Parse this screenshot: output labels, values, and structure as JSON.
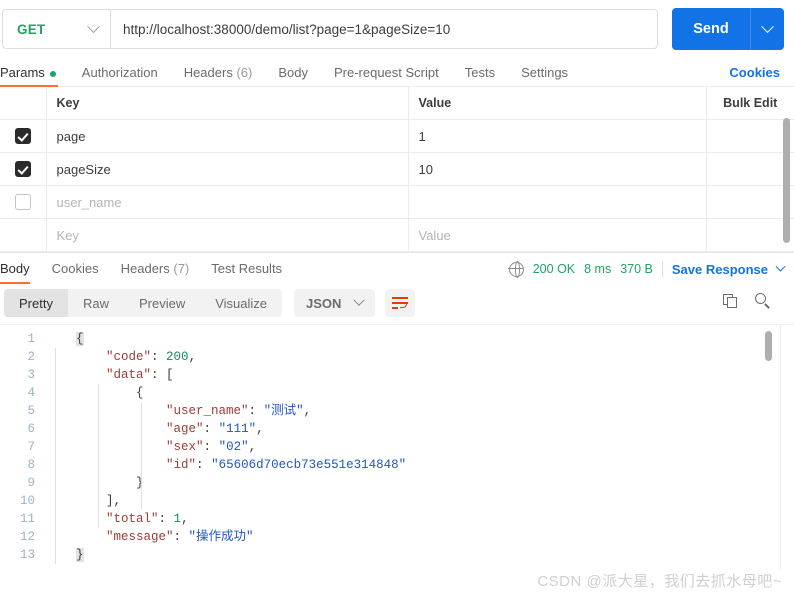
{
  "request": {
    "method": "GET",
    "url": "http://localhost:38000/demo/list?page=1&pageSize=10",
    "send_label": "Send",
    "tabs": [
      {
        "label": "Params",
        "badge": "",
        "active": true,
        "dot": true
      },
      {
        "label": "Authorization",
        "badge": "",
        "active": false,
        "dot": false
      },
      {
        "label": "Headers",
        "badge": "(6)",
        "active": false,
        "dot": false
      },
      {
        "label": "Body",
        "badge": "",
        "active": false,
        "dot": false
      },
      {
        "label": "Pre-request Script",
        "badge": "",
        "active": false,
        "dot": false
      },
      {
        "label": "Tests",
        "badge": "",
        "active": false,
        "dot": false
      },
      {
        "label": "Settings",
        "badge": "",
        "active": false,
        "dot": false
      }
    ],
    "cookies_link": "Cookies"
  },
  "params_table": {
    "headers": {
      "key": "Key",
      "value": "Value",
      "bulk_edit": "Bulk Edit"
    },
    "rows": [
      {
        "checked": true,
        "key": "page",
        "value": "1",
        "placeholder": false
      },
      {
        "checked": true,
        "key": "pageSize",
        "value": "10",
        "placeholder": false
      },
      {
        "checked": false,
        "key": "user_name",
        "value": "",
        "placeholder": true
      },
      {
        "checked": null,
        "key": "Key",
        "value": "Value",
        "placeholder": true
      }
    ]
  },
  "response": {
    "tabs": [
      {
        "label": "Body",
        "badge": "",
        "active": true
      },
      {
        "label": "Cookies",
        "badge": "",
        "active": false
      },
      {
        "label": "Headers",
        "badge": "(7)",
        "active": false
      },
      {
        "label": "Test Results",
        "badge": "",
        "active": false
      }
    ],
    "status": "200 OK",
    "time": "8 ms",
    "size": "370 B",
    "save_response": "Save Response",
    "view_modes": [
      {
        "label": "Pretty",
        "active": true
      },
      {
        "label": "Raw",
        "active": false
      },
      {
        "label": "Preview",
        "active": false
      },
      {
        "label": "Visualize",
        "active": false
      }
    ],
    "format": "JSON",
    "body_lines": [
      {
        "n": "1",
        "indent": 0,
        "tokens": [
          {
            "t": "{",
            "c": "brace-hl"
          }
        ]
      },
      {
        "n": "2",
        "indent": 1,
        "tokens": [
          {
            "t": "\"code\"",
            "c": "k-key"
          },
          {
            "t": ": ",
            "c": "k-pun"
          },
          {
            "t": "200",
            "c": "k-num"
          },
          {
            "t": ",",
            "c": "k-pun"
          }
        ]
      },
      {
        "n": "3",
        "indent": 1,
        "tokens": [
          {
            "t": "\"data\"",
            "c": "k-key"
          },
          {
            "t": ": [",
            "c": "k-pun"
          }
        ]
      },
      {
        "n": "4",
        "indent": 2,
        "tokens": [
          {
            "t": "{",
            "c": "k-pun"
          }
        ]
      },
      {
        "n": "5",
        "indent": 3,
        "tokens": [
          {
            "t": "\"user_name\"",
            "c": "k-key"
          },
          {
            "t": ": ",
            "c": "k-pun"
          },
          {
            "t": "\"测试\"",
            "c": "k-str"
          },
          {
            "t": ",",
            "c": "k-pun"
          }
        ]
      },
      {
        "n": "6",
        "indent": 3,
        "tokens": [
          {
            "t": "\"age\"",
            "c": "k-key"
          },
          {
            "t": ": ",
            "c": "k-pun"
          },
          {
            "t": "\"111\"",
            "c": "k-str"
          },
          {
            "t": ",",
            "c": "k-pun"
          }
        ]
      },
      {
        "n": "7",
        "indent": 3,
        "tokens": [
          {
            "t": "\"sex\"",
            "c": "k-key"
          },
          {
            "t": ": ",
            "c": "k-pun"
          },
          {
            "t": "\"02\"",
            "c": "k-str"
          },
          {
            "t": ",",
            "c": "k-pun"
          }
        ]
      },
      {
        "n": "8",
        "indent": 3,
        "tokens": [
          {
            "t": "\"id\"",
            "c": "k-key"
          },
          {
            "t": ": ",
            "c": "k-pun"
          },
          {
            "t": "\"65606d70ecb73e551e314848\"",
            "c": "k-str"
          }
        ]
      },
      {
        "n": "9",
        "indent": 2,
        "tokens": [
          {
            "t": "}",
            "c": "k-pun"
          }
        ]
      },
      {
        "n": "10",
        "indent": 1,
        "tokens": [
          {
            "t": "],",
            "c": "k-pun"
          }
        ]
      },
      {
        "n": "11",
        "indent": 1,
        "tokens": [
          {
            "t": "\"total\"",
            "c": "k-key"
          },
          {
            "t": ": ",
            "c": "k-pun"
          },
          {
            "t": "1",
            "c": "k-num"
          },
          {
            "t": ",",
            "c": "k-pun"
          }
        ]
      },
      {
        "n": "12",
        "indent": 1,
        "tokens": [
          {
            "t": "\"message\"",
            "c": "k-key"
          },
          {
            "t": ": ",
            "c": "k-pun"
          },
          {
            "t": "\"操作成功\"",
            "c": "k-str"
          }
        ]
      },
      {
        "n": "13",
        "indent": 0,
        "tokens": [
          {
            "t": "}",
            "c": "brace-hl"
          }
        ]
      }
    ]
  },
  "watermark": "CSDN @派大星，我们去抓水母吧~",
  "colors": {
    "accent_orange": "#ff6c37",
    "link_blue": "#1273e6",
    "method_green": "#1fa463",
    "status_green": "#1fa463"
  }
}
